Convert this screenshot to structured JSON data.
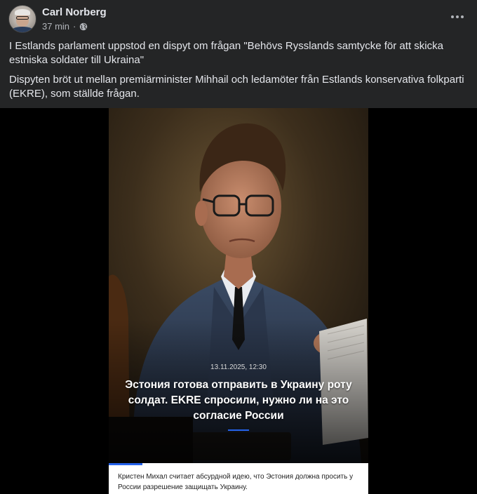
{
  "post": {
    "author": "Carl Norberg",
    "time": "37 min",
    "separator": "·",
    "privacy_icon": "globe-icon",
    "more_icon": "more-horizontal-icon",
    "paragraphs": [
      "I Estlands parlament uppstod en dispyt om frågan \"Behövs Rysslands samtycke för att skicka estniska soldater till Ukraina\"",
      "Dispyten bröt ut mellan premiärminister Mihhail och ledamöter från Estlands konservativa folkparti (EKRE), som ställde frågan."
    ]
  },
  "media": {
    "date": "13.11.2025, 12:30",
    "headline": "Эстония готова отправить в Украину роту солдат. EKRE спросили, нужно ли на это согласие России",
    "caption": "Кристен Михал считает абсурдной идею, что Эстония должна просить у России разрешение защищать Украину.",
    "accent_color": "#2563eb"
  },
  "colors": {
    "background": "#242526",
    "text_primary": "#e4e6eb",
    "text_secondary": "#b0b3b8"
  }
}
